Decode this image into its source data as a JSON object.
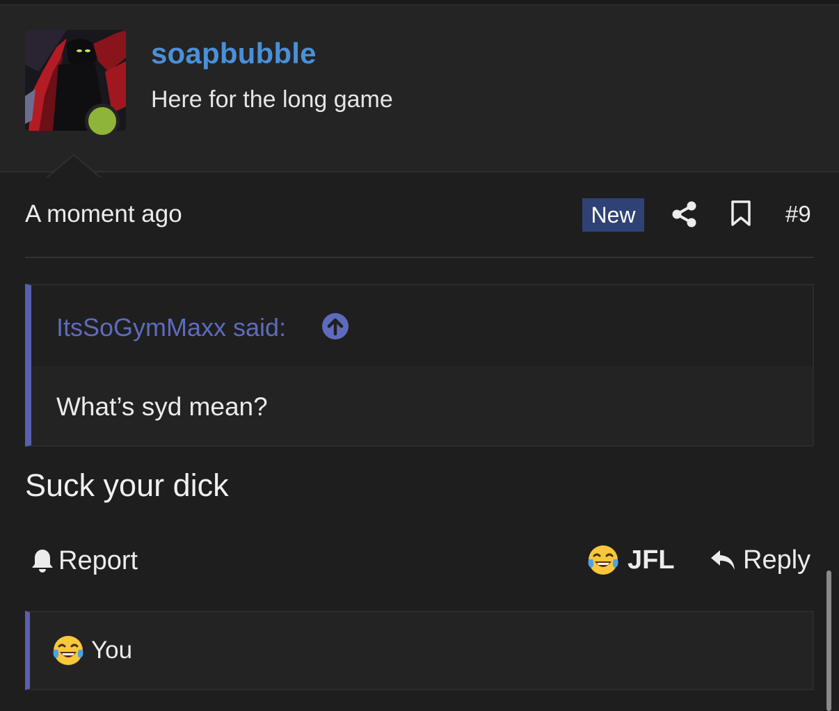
{
  "user": {
    "name": "soapbubble",
    "title": "Here for the long game",
    "online": true,
    "colors": {
      "name": "#4a90d9",
      "online": "#8fb43a"
    }
  },
  "meta": {
    "time": "A moment ago",
    "badge": "New",
    "post_number": "#9",
    "badge_color": "#2f4275"
  },
  "quote": {
    "author_line": "ItsSoGymMaxx said:",
    "text": "What’s syd mean?",
    "accent_color": "#5860b0"
  },
  "message": "Suck your dick",
  "actions": {
    "report": "Report",
    "reaction": "JFL",
    "reply": "Reply"
  },
  "reactions": {
    "summary": "You"
  },
  "icons": {
    "share": "share-icon",
    "bookmark": "bookmark-icon",
    "jump": "arrow-up-circle-icon",
    "report": "bell-icon",
    "reply": "reply-icon",
    "reaction": "crying-laughing-emoji"
  }
}
